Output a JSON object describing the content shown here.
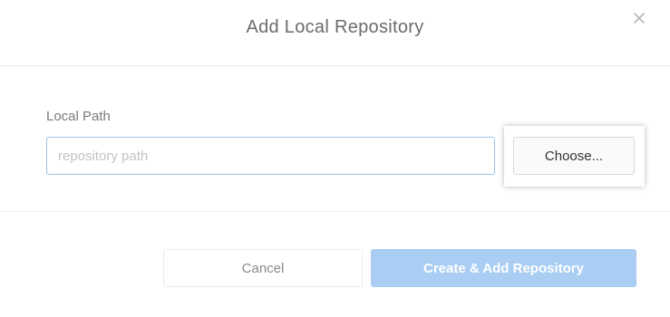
{
  "dialog": {
    "title": "Add Local Repository",
    "close_icon": "close-icon"
  },
  "form": {
    "local_path_label": "Local Path",
    "path_placeholder": "repository path",
    "path_value": "",
    "choose_label": "Choose..."
  },
  "footer": {
    "cancel_label": "Cancel",
    "create_label": "Create & Add Repository"
  },
  "colors": {
    "primary_disabled": "#a9cdf3",
    "input_focus_border": "#9cc0e6"
  }
}
